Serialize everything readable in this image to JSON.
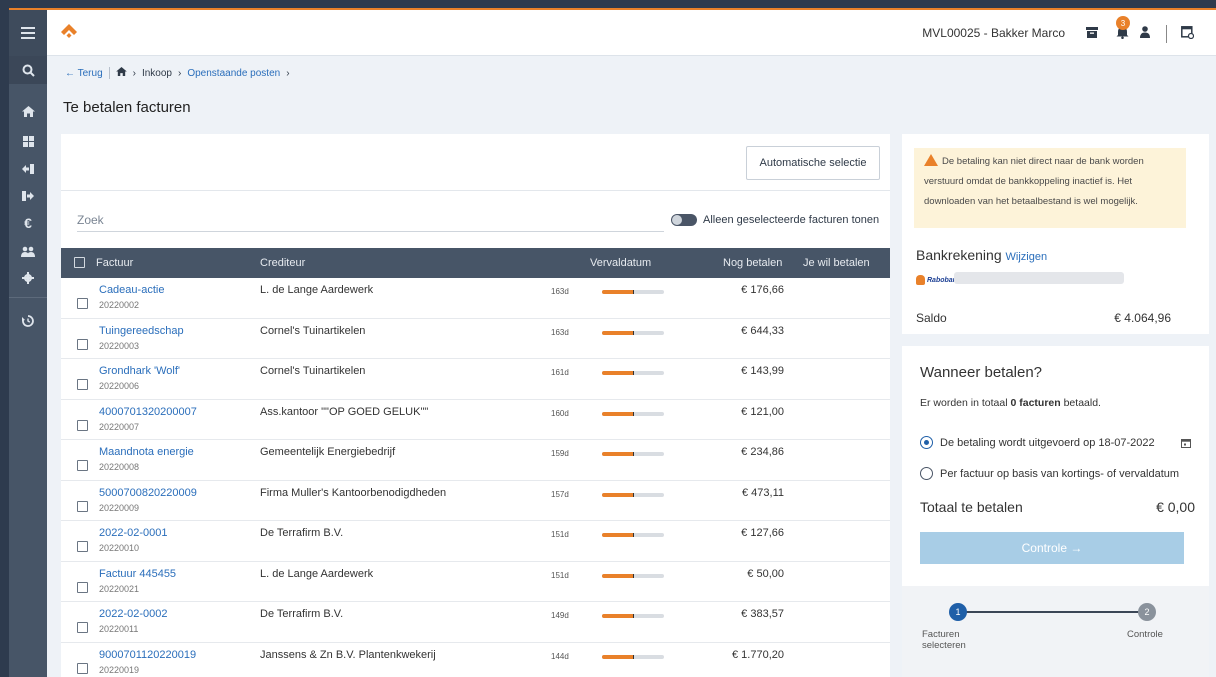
{
  "header": {
    "user": "MVL00025 - Bakker Marco",
    "notifications": "3",
    "accent_color": "#e9812a"
  },
  "breadcrumb": {
    "back": "Terug",
    "inkoop": "Inkoop",
    "current": "Openstaande posten"
  },
  "page_title": "Te betalen facturen",
  "toolbar": {
    "auto_select": "Automatische selectie",
    "search_placeholder": "Zoek",
    "toggle_label": "Alleen geselecteerde facturen tonen"
  },
  "table": {
    "headers": {
      "factuur": "Factuur",
      "crediteur": "Crediteur",
      "vervaldatum": "Vervaldatum",
      "nog_betalen": "Nog betalen",
      "je_wil_betalen": "Je wil betalen"
    },
    "rows": [
      {
        "name": "Cadeau-actie",
        "number": "20220002",
        "creditor": "L. de Lange Aardewerk",
        "days": "163d",
        "amount": "€ 176,66"
      },
      {
        "name": "Tuingereedschap",
        "number": "20220003",
        "creditor": "Cornel's Tuinartikelen",
        "days": "163d",
        "amount": "€ 644,33"
      },
      {
        "name": "Grondhark 'Wolf'",
        "number": "20220006",
        "creditor": "Cornel's Tuinartikelen",
        "days": "161d",
        "amount": "€ 143,99"
      },
      {
        "name": "4000701320200007",
        "number": "20220007",
        "creditor": "Ass.kantoor \"\"OP GOED GELUK\"\"",
        "days": "160d",
        "amount": "€ 121,00"
      },
      {
        "name": "Maandnota energie",
        "number": "20220008",
        "creditor": "Gemeentelijk Energiebedrijf",
        "days": "159d",
        "amount": "€ 234,86"
      },
      {
        "name": "5000700820220009",
        "number": "20220009",
        "creditor": "Firma Muller's Kantoorbenodigdheden",
        "days": "157d",
        "amount": "€ 473,11"
      },
      {
        "name": "2022-02-0001",
        "number": "20220010",
        "creditor": "De Terrafirm B.V.",
        "days": "151d",
        "amount": "€ 127,66"
      },
      {
        "name": "Factuur 445455",
        "number": "20220021",
        "creditor": "L. de Lange Aardewerk",
        "days": "151d",
        "amount": "€ 50,00"
      },
      {
        "name": "2022-02-0002",
        "number": "20220011",
        "creditor": "De Terrafirm B.V.",
        "days": "149d",
        "amount": "€ 383,57"
      },
      {
        "name": "9000701120220019",
        "number": "20220019",
        "creditor": "Janssens & Zn B.V. Plantenkwekerij",
        "days": "144d",
        "amount": "€ 1.770,20"
      }
    ]
  },
  "bank": {
    "warning": "De betaling kan niet direct naar de bank worden verstuurd omdat de bankkoppeling inactief is. Het downloaden van het betaalbestand is wel mogelijk.",
    "title": "Bankrekening",
    "change": "Wijzigen",
    "bank_name": "Rabobank",
    "saldo_label": "Saldo",
    "saldo_value": "€ 4.064,96"
  },
  "payment": {
    "title": "Wanneer betalen?",
    "sub_prefix": "Er worden in totaal",
    "sub_bold": "0 facturen",
    "sub_suffix": "betaald.",
    "option1": "De betaling wordt uitgevoerd op 18-07-2022",
    "option2": "Per factuur op basis van kortings- of vervaldatum",
    "total_label": "Totaal te betalen",
    "total_value": "€ 0,00",
    "button": "Controle →"
  },
  "steps": [
    {
      "num": "1",
      "label": "Facturen selecteren",
      "color": "#1f5fa8"
    },
    {
      "num": "2",
      "label": "Controle",
      "color": "#8a929c"
    }
  ]
}
